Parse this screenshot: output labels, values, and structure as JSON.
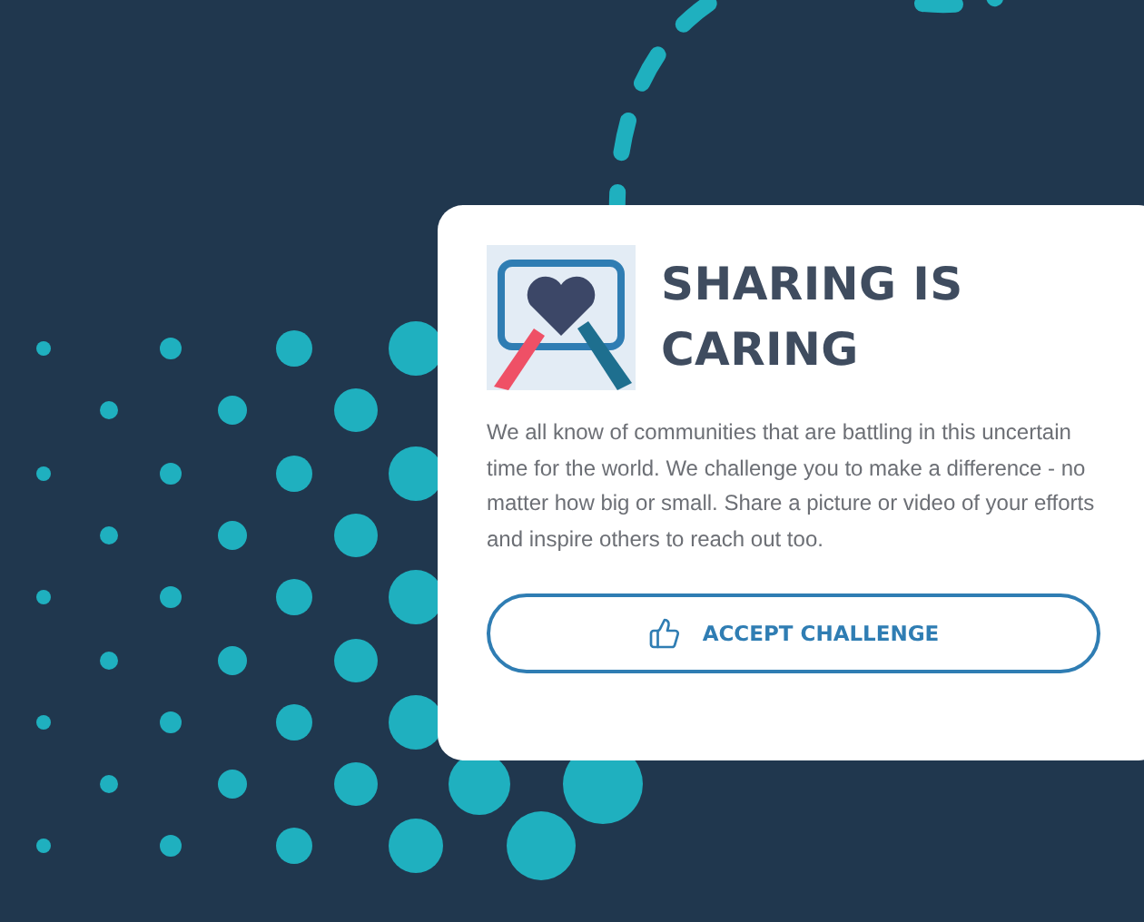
{
  "card": {
    "title": "SHARING IS CARING",
    "body": "We all know of communities that are battling in this uncertain time for the world. We challenge you to make a difference - no matter how big or small. Share a picture or video of your efforts and inspire others to reach out too.",
    "button": {
      "label": "ACCEPT CHALLENGE"
    }
  }
}
